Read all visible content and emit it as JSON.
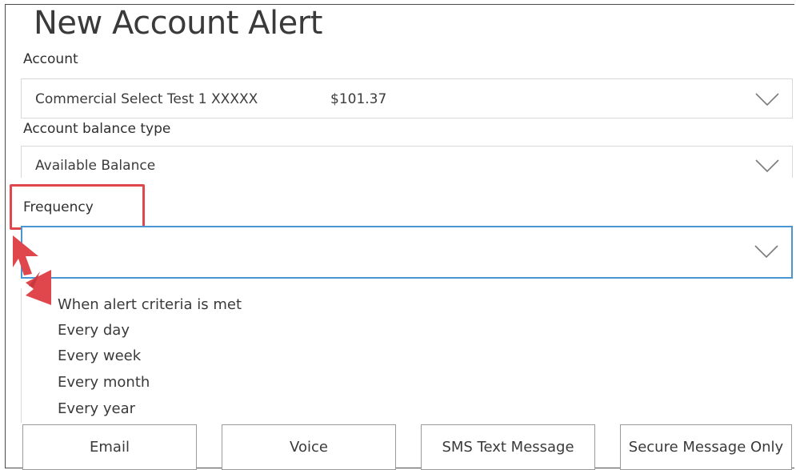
{
  "page": {
    "title": "New Account Alert"
  },
  "account": {
    "label": "Account",
    "value": "Commercial Select Test 1 XXXXX",
    "amount": "$101.37"
  },
  "balance_type": {
    "label": "Account balance type",
    "value": "Available Balance"
  },
  "frequency": {
    "label": "Frequency",
    "value": "",
    "options": [
      "When alert criteria is met",
      "Every day",
      "Every week",
      "Every month",
      "Every year"
    ]
  },
  "delivery": {
    "buttons": [
      "Email",
      "Voice",
      "SMS Text Message",
      "Secure Message Only"
    ]
  },
  "colors": {
    "highlight": "#e0474c",
    "focus_border": "#4a96d2"
  },
  "icons": {
    "dropdown": "chevron-down-icon",
    "annotation": "red-arrow-icon"
  }
}
